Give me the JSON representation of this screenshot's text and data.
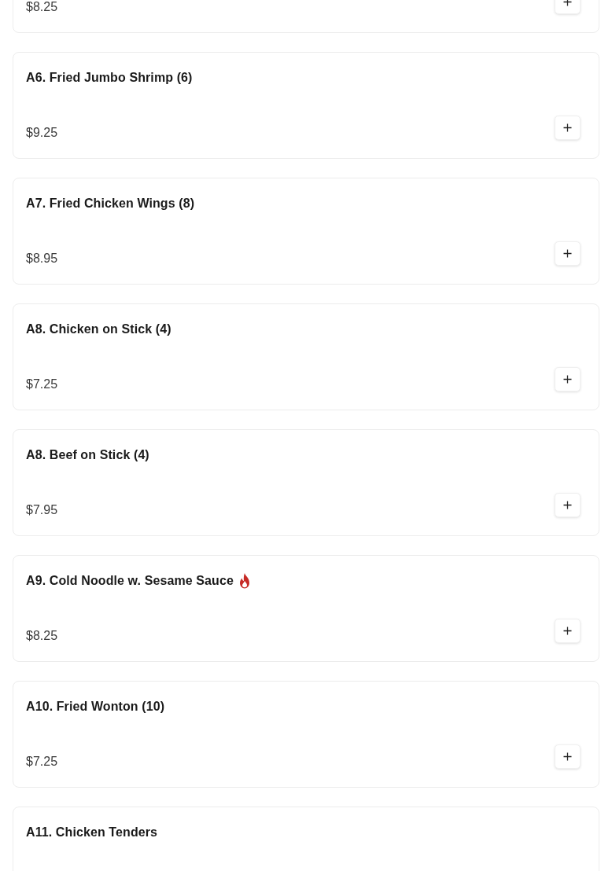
{
  "menu_items": [
    {
      "price": "$8.25"
    },
    {
      "name": "A6. Fried Jumbo Shrimp (6)",
      "price": "$9.25",
      "spicy": false
    },
    {
      "name": "A7. Fried Chicken Wings (8)",
      "price": "$8.95",
      "spicy": false
    },
    {
      "name": "A8. Chicken on Stick (4)",
      "price": "$7.25",
      "spicy": false
    },
    {
      "name": "A8. Beef on Stick (4)",
      "price": "$7.95",
      "spicy": false
    },
    {
      "name": "A9. Cold Noodle w. Sesame Sauce",
      "price": "$8.25",
      "spicy": true
    },
    {
      "name": "A10. Fried Wonton (10)",
      "price": "$7.25",
      "spicy": false
    },
    {
      "name": "A11. Chicken Tenders",
      "spicy": false
    }
  ]
}
